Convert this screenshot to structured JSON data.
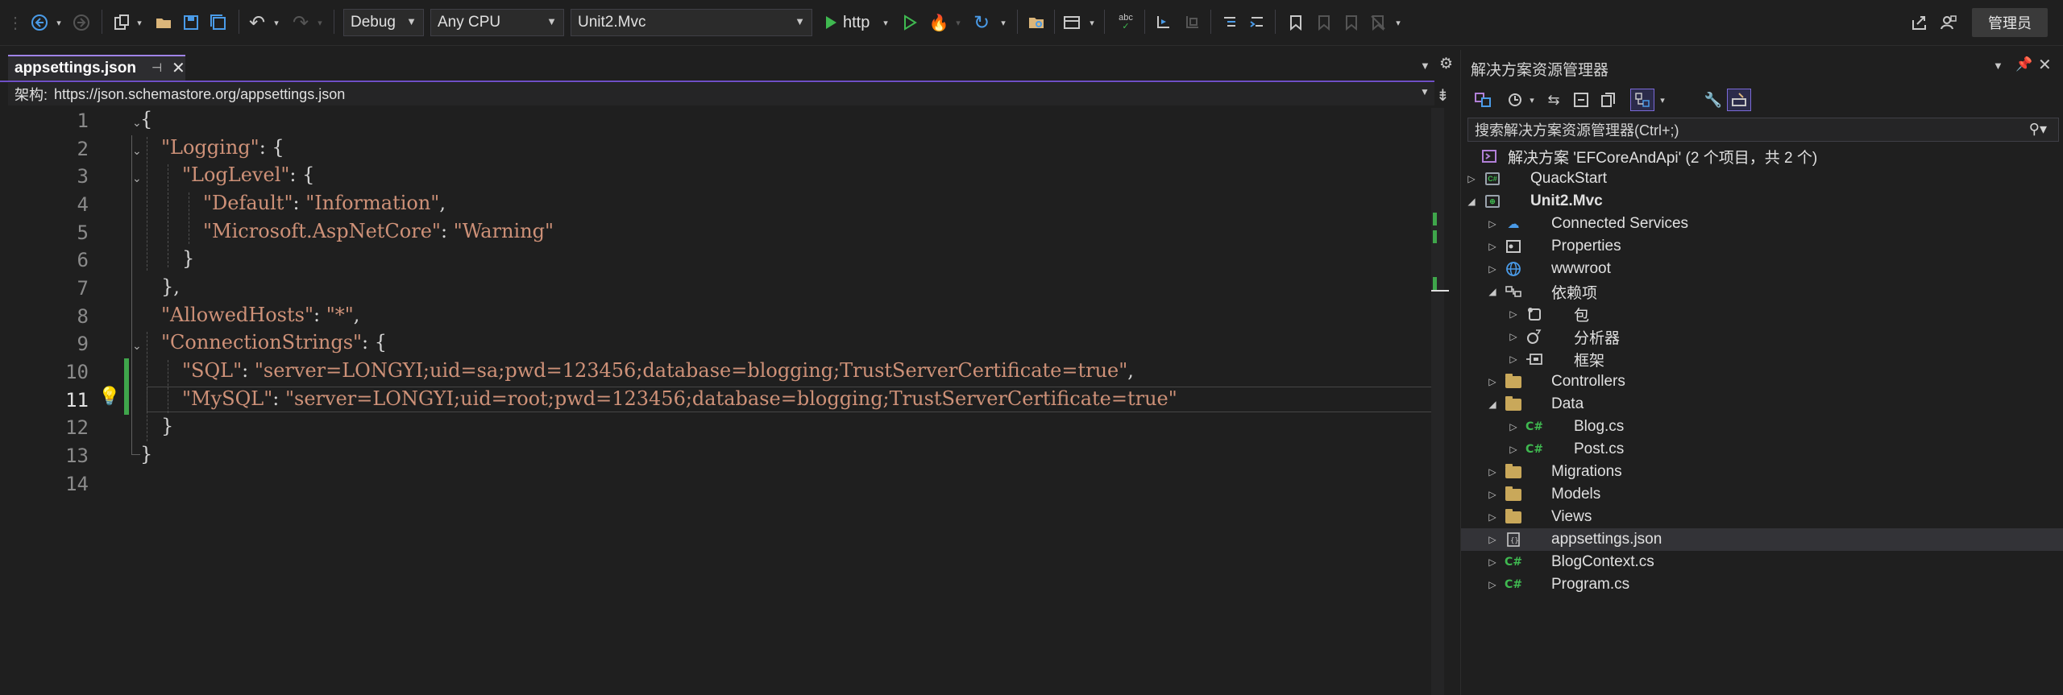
{
  "toolbar": {
    "config": "Debug",
    "platform": "Any CPU",
    "startup_project": "Unit2.Mvc",
    "run_label": "http",
    "admin_label": "管理员"
  },
  "editor": {
    "tab_title": "appsettings.json",
    "schema_label": "架构:",
    "schema_url": "https://json.schemastore.org/appsettings.json",
    "line_numbers": [
      "1",
      "2",
      "3",
      "4",
      "5",
      "6",
      "7",
      "8",
      "9",
      "10",
      "11",
      "12",
      "13",
      "14"
    ],
    "code": {
      "l1": "{",
      "l2_key": "\"Logging\"",
      "l2_rest": ": {",
      "l3_key": "\"LogLevel\"",
      "l3_rest": ": {",
      "l4_key": "\"Default\"",
      "l4_sep": ": ",
      "l4_val": "\"Information\"",
      "l4_end": ",",
      "l5_key": "\"Microsoft.AspNetCore\"",
      "l5_sep": ": ",
      "l5_val": "\"Warning\"",
      "l6": "}",
      "l7": "},",
      "l8_key": "\"AllowedHosts\"",
      "l8_sep": ": ",
      "l8_val": "\"*\"",
      "l8_end": ",",
      "l9_key": "\"ConnectionStrings\"",
      "l9_rest": ": {",
      "l10_key": "\"SQL\"",
      "l10_sep": ": ",
      "l10_val": "\"server=LONGYI;uid=sa;pwd=123456;database=blogging;TrustServerCertificate=true\"",
      "l10_end": ",",
      "l11_key": "\"MySQL\"",
      "l11_sep": ": ",
      "l11_val": "\"server=LONGYI;uid=root;pwd=123456;database=blogging;TrustServerCertificate=true\"",
      "l12": "}",
      "l13": "}"
    }
  },
  "solution_explorer": {
    "title": "解决方案资源管理器",
    "search_placeholder": "搜索解决方案资源管理器(Ctrl+;)",
    "items": [
      {
        "label": "解决方案 'EFCoreAndApi' (2 个项目，共 2 个)",
        "icon": "solution-icon"
      },
      {
        "label": "QuackStart",
        "icon": "csharp-project-icon"
      },
      {
        "label": "Unit2.Mvc",
        "icon": "web-project-icon"
      },
      {
        "label": "Connected Services",
        "icon": "connected-services-icon"
      },
      {
        "label": "Properties",
        "icon": "properties-icon"
      },
      {
        "label": "wwwroot",
        "icon": "globe-icon"
      },
      {
        "label": "依赖项",
        "icon": "dependencies-icon"
      },
      {
        "label": "包",
        "icon": "package-icon"
      },
      {
        "label": "分析器",
        "icon": "analyzer-icon"
      },
      {
        "label": "框架",
        "icon": "framework-icon"
      },
      {
        "label": "Controllers",
        "icon": "folder-icon"
      },
      {
        "label": "Data",
        "icon": "folder-icon"
      },
      {
        "label": "Blog.cs",
        "icon": "csharp-file-icon"
      },
      {
        "label": "Post.cs",
        "icon": "csharp-file-icon"
      },
      {
        "label": "Migrations",
        "icon": "folder-icon"
      },
      {
        "label": "Models",
        "icon": "folder-icon"
      },
      {
        "label": "Views",
        "icon": "folder-icon"
      },
      {
        "label": "appsettings.json",
        "icon": "json-file-icon"
      },
      {
        "label": "BlogContext.cs",
        "icon": "csharp-file-icon"
      },
      {
        "label": "Program.cs",
        "icon": "csharp-file-icon"
      }
    ]
  }
}
